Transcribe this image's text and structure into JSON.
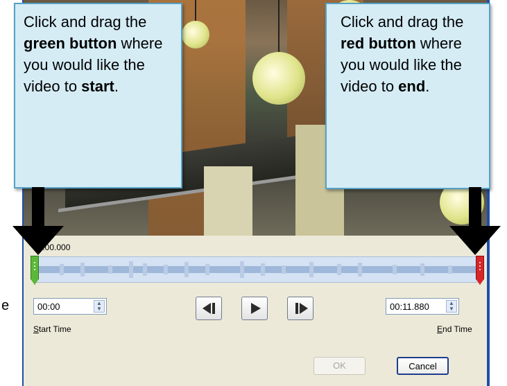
{
  "video_trim": {
    "position_label": "00:00.000",
    "start_time": {
      "value": "00:00",
      "label": "Start Time"
    },
    "end_time": {
      "value": "00:11.880",
      "label": "End Time"
    },
    "buttons": {
      "ok": "OK",
      "cancel": "Cancel"
    },
    "start_handle_color": "#5cb83a",
    "end_handle_color": "#d6262a"
  },
  "annotations": {
    "left": {
      "pre": "Click and drag the ",
      "bold1": "green button",
      "mid": " where you would like the video to ",
      "bold2": "start",
      "post": "."
    },
    "right": {
      "pre": "Click and drag the ",
      "bold1": "red button",
      "mid": " where you would like the video to ",
      "bold2": "end",
      "post": "."
    },
    "stray_char": "e"
  },
  "icons": [
    "previous-frame-icon",
    "play-icon",
    "next-frame-icon",
    "spinner-arrows-icon",
    "arrow-down-icon"
  ]
}
